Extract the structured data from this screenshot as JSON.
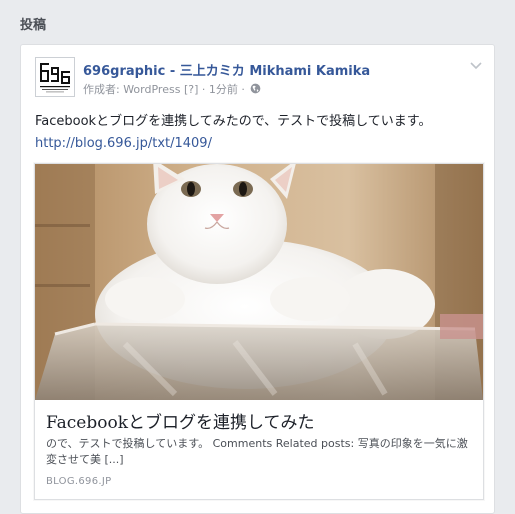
{
  "section": {
    "title": "投稿"
  },
  "post": {
    "author": "696graphic - 三上カミカ Mikhami Kamika",
    "meta": {
      "prefix": "作成者: ",
      "app": "WordPress",
      "help": "[?]",
      "separator": " · ",
      "time": "1分前",
      "separator2": " · "
    },
    "text": "Facebookとブログを連携してみたので、テストで投稿しています。",
    "link": "http://blog.696.jp/txt/1409/",
    "logo": {
      "text_lines": [
        "696graphic",
        "696.jp"
      ]
    },
    "attachment": {
      "title": "Facebookとブログを連携してみた",
      "description": "ので、テストで投稿しています。 Comments Related posts: 写真の印象を一気に激変させて美 [...]",
      "domain": "BLOG.696.JP"
    }
  },
  "icons": {
    "globe": "globe-icon",
    "chevron": "chevron-down-icon",
    "logo": "696graphic-logo"
  },
  "colors": {
    "link": "#365899",
    "background": "#e9ebee",
    "meta": "#90949c"
  }
}
